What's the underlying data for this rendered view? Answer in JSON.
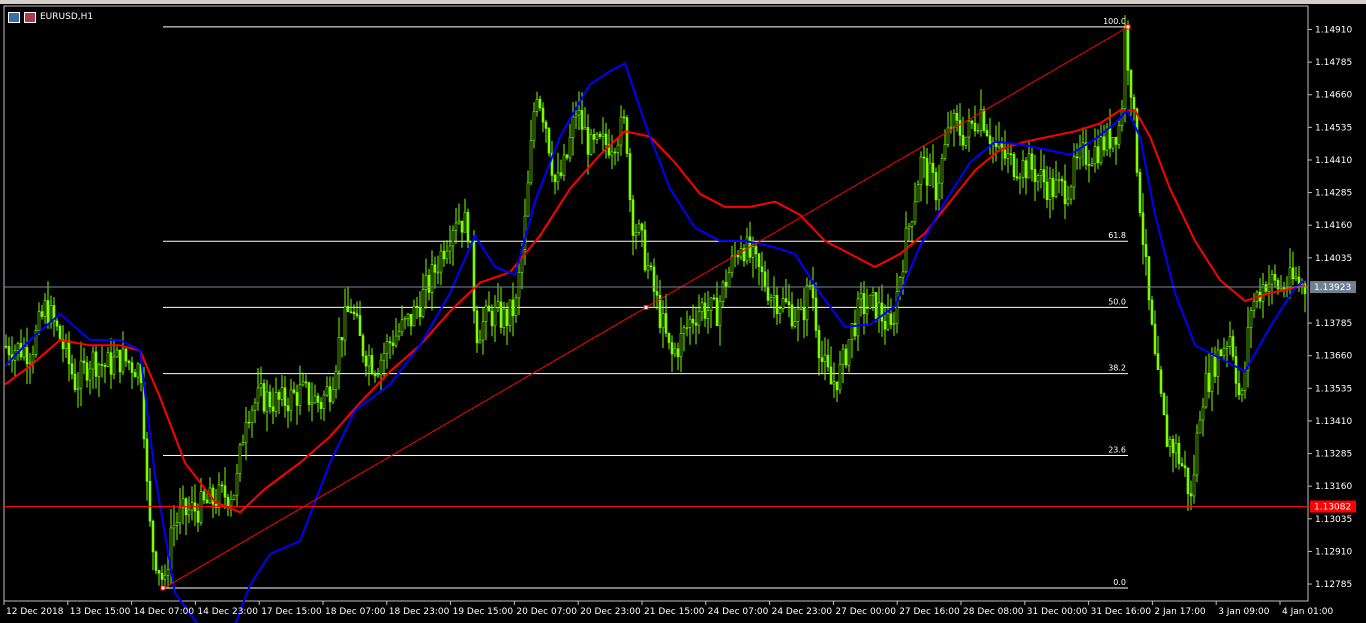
{
  "window": {
    "symbol_title": "EURUSD,H1"
  },
  "colors": {
    "background": "#000000",
    "candle": "#7cfc00",
    "ma_fast": "#0000ff",
    "ma_slow": "#ff0000",
    "fib": "#ffffff",
    "trend": "#ff0000",
    "bid_line": "#778899",
    "hline": "#ff0000"
  },
  "chart_data": {
    "type": "candlestick",
    "symbol": "EURUSD",
    "timeframe": "H1",
    "y_ticks": [
      "1.14910",
      "1.14785",
      "1.14660",
      "1.14535",
      "1.14410",
      "1.14285",
      "1.14160",
      "1.14035",
      "1.13785",
      "1.13660",
      "1.13535",
      "1.13410",
      "1.13285",
      "1.13160",
      "1.13035",
      "1.12910",
      "1.12785"
    ],
    "y_range": [
      1.1272,
      1.15
    ],
    "x_ticks": [
      "12 Dec 2018",
      "13 Dec 15:00",
      "14 Dec 07:00",
      "14 Dec 23:00",
      "17 Dec 15:00",
      "18 Dec 07:00",
      "18 Dec 23:00",
      "19 Dec 15:00",
      "20 Dec 07:00",
      "20 Dec 23:00",
      "21 Dec 15:00",
      "24 Dec 07:00",
      "24 Dec 23:00",
      "27 Dec 00:00",
      "27 Dec 16:00",
      "28 Dec 08:00",
      "31 Dec 00:00",
      "31 Dec 16:00",
      "2 Jan 17:00",
      "3 Jan 09:00",
      "4 Jan 01:00"
    ],
    "current_price": {
      "label": "1.13923",
      "value": 1.13923
    },
    "horizontal_line": {
      "label": "1.13082",
      "value": 1.13082
    },
    "fibonacci": {
      "from": 1.1277,
      "to": 1.1492,
      "levels": [
        {
          "label": "100.0",
          "ratio": 1.0
        },
        {
          "label": "61.8",
          "ratio": 0.618
        },
        {
          "label": "50.0",
          "ratio": 0.5
        },
        {
          "label": "38.2",
          "ratio": 0.382
        },
        {
          "label": "23.6",
          "ratio": 0.236
        },
        {
          "label": "0.0",
          "ratio": 0.0
        }
      ]
    },
    "close_path": [
      [
        0,
        1.137
      ],
      [
        30,
        1.1368
      ],
      [
        45,
        1.1385
      ],
      [
        60,
        1.1372
      ],
      [
        75,
        1.1355
      ],
      [
        90,
        1.1365
      ],
      [
        105,
        1.1362
      ],
      [
        120,
        1.1365
      ],
      [
        135,
        1.1362
      ],
      [
        141,
        1.136
      ],
      [
        145,
        1.132
      ],
      [
        150,
        1.1295
      ],
      [
        158,
        1.1285
      ],
      [
        164,
        1.1277
      ],
      [
        170,
        1.13
      ],
      [
        180,
        1.1305
      ],
      [
        200,
        1.1308
      ],
      [
        220,
        1.1312
      ],
      [
        235,
        1.1315
      ],
      [
        245,
        1.1345
      ],
      [
        260,
        1.135
      ],
      [
        280,
        1.1348
      ],
      [
        300,
        1.1352
      ],
      [
        320,
        1.1348
      ],
      [
        330,
        1.1355
      ],
      [
        340,
        1.1375
      ],
      [
        350,
        1.1385
      ],
      [
        360,
        1.137
      ],
      [
        375,
        1.1362
      ],
      [
        390,
        1.1372
      ],
      [
        410,
        1.138
      ],
      [
        430,
        1.1395
      ],
      [
        445,
        1.141
      ],
      [
        455,
        1.142
      ],
      [
        468,
        1.1415
      ],
      [
        475,
        1.1375
      ],
      [
        490,
        1.1382
      ],
      [
        505,
        1.138
      ],
      [
        515,
        1.1385
      ],
      [
        525,
        1.142
      ],
      [
        535,
        1.147
      ],
      [
        545,
        1.1455
      ],
      [
        555,
        1.143
      ],
      [
        565,
        1.144
      ],
      [
        575,
        1.146
      ],
      [
        590,
        1.1445
      ],
      [
        610,
        1.1448
      ],
      [
        625,
        1.1455
      ],
      [
        630,
        1.142
      ],
      [
        640,
        1.141
      ],
      [
        650,
        1.1395
      ],
      [
        660,
        1.138
      ],
      [
        670,
        1.1365
      ],
      [
        680,
        1.1372
      ],
      [
        690,
        1.138
      ],
      [
        700,
        1.1385
      ],
      [
        715,
        1.1382
      ],
      [
        725,
        1.1395
      ],
      [
        740,
        1.141
      ],
      [
        755,
        1.14
      ],
      [
        770,
        1.139
      ],
      [
        785,
        1.1385
      ],
      [
        800,
        1.138
      ],
      [
        810,
        1.1395
      ],
      [
        820,
        1.1365
      ],
      [
        830,
        1.1355
      ],
      [
        840,
        1.136
      ],
      [
        850,
        1.1375
      ],
      [
        860,
        1.1385
      ],
      [
        875,
        1.1385
      ],
      [
        890,
        1.1375
      ],
      [
        900,
        1.14
      ],
      [
        910,
        1.142
      ],
      [
        920,
        1.144
      ],
      [
        935,
        1.143
      ],
      [
        950,
        1.1455
      ],
      [
        965,
        1.145
      ],
      [
        980,
        1.146
      ],
      [
        995,
        1.1445
      ],
      [
        1010,
        1.144
      ],
      [
        1030,
        1.1438
      ],
      [
        1050,
        1.143
      ],
      [
        1065,
        1.143
      ],
      [
        1080,
        1.1442
      ],
      [
        1095,
        1.1445
      ],
      [
        1110,
        1.145
      ],
      [
        1120,
        1.1455
      ],
      [
        1124,
        1.149
      ],
      [
        1130,
        1.147
      ],
      [
        1140,
        1.142
      ],
      [
        1148,
        1.1385
      ],
      [
        1155,
        1.136
      ],
      [
        1165,
        1.1335
      ],
      [
        1175,
        1.133
      ],
      [
        1185,
        1.132
      ],
      [
        1190,
        1.131
      ],
      [
        1200,
        1.135
      ],
      [
        1215,
        1.1365
      ],
      [
        1230,
        1.1375
      ],
      [
        1240,
        1.1345
      ],
      [
        1250,
        1.1385
      ],
      [
        1265,
        1.1395
      ],
      [
        1280,
        1.1392
      ],
      [
        1295,
        1.1395
      ],
      [
        1305,
        1.1392
      ]
    ],
    "ma_fast_path": [
      [
        5,
        1.1362
      ],
      [
        30,
        1.1372
      ],
      [
        60,
        1.1382
      ],
      [
        90,
        1.1372
      ],
      [
        120,
        1.1372
      ],
      [
        140,
        1.1368
      ],
      [
        155,
        1.132
      ],
      [
        175,
        1.1275
      ],
      [
        200,
        1.1262
      ],
      [
        230,
        1.1258
      ],
      [
        250,
        1.1278
      ],
      [
        270,
        1.129
      ],
      [
        300,
        1.1295
      ],
      [
        330,
        1.1325
      ],
      [
        355,
        1.1345
      ],
      [
        390,
        1.1355
      ],
      [
        420,
        1.137
      ],
      [
        450,
        1.139
      ],
      [
        475,
        1.1412
      ],
      [
        495,
        1.14
      ],
      [
        515,
        1.1397
      ],
      [
        535,
        1.1425
      ],
      [
        560,
        1.145
      ],
      [
        590,
        1.147
      ],
      [
        610,
        1.1475
      ],
      [
        625,
        1.1478
      ],
      [
        645,
        1.1455
      ],
      [
        670,
        1.143
      ],
      [
        695,
        1.1415
      ],
      [
        720,
        1.141
      ],
      [
        745,
        1.141
      ],
      [
        770,
        1.1408
      ],
      [
        795,
        1.1405
      ],
      [
        820,
        1.139
      ],
      [
        845,
        1.1377
      ],
      [
        870,
        1.1378
      ],
      [
        895,
        1.1385
      ],
      [
        920,
        1.1408
      ],
      [
        945,
        1.1425
      ],
      [
        970,
        1.144
      ],
      [
        995,
        1.1448
      ],
      [
        1020,
        1.1447
      ],
      [
        1045,
        1.1445
      ],
      [
        1070,
        1.1443
      ],
      [
        1095,
        1.1449
      ],
      [
        1115,
        1.1455
      ],
      [
        1127,
        1.146
      ],
      [
        1140,
        1.145
      ],
      [
        1155,
        1.142
      ],
      [
        1175,
        1.139
      ],
      [
        1195,
        1.137
      ],
      [
        1220,
        1.1365
      ],
      [
        1245,
        1.136
      ],
      [
        1270,
        1.1377
      ],
      [
        1295,
        1.1392
      ],
      [
        1305,
        1.1395
      ]
    ],
    "ma_slow_path": [
      [
        5,
        1.1355
      ],
      [
        30,
        1.1362
      ],
      [
        60,
        1.1372
      ],
      [
        90,
        1.137
      ],
      [
        120,
        1.137
      ],
      [
        140,
        1.1368
      ],
      [
        160,
        1.135
      ],
      [
        185,
        1.1325
      ],
      [
        215,
        1.131
      ],
      [
        240,
        1.1306
      ],
      [
        265,
        1.1315
      ],
      [
        300,
        1.1325
      ],
      [
        330,
        1.1335
      ],
      [
        360,
        1.1348
      ],
      [
        390,
        1.136
      ],
      [
        420,
        1.137
      ],
      [
        450,
        1.1383
      ],
      [
        480,
        1.1394
      ],
      [
        510,
        1.1398
      ],
      [
        540,
        1.1412
      ],
      [
        570,
        1.143
      ],
      [
        600,
        1.1443
      ],
      [
        625,
        1.1452
      ],
      [
        650,
        1.145
      ],
      [
        675,
        1.144
      ],
      [
        700,
        1.1428
      ],
      [
        725,
        1.1423
      ],
      [
        750,
        1.1423
      ],
      [
        775,
        1.1425
      ],
      [
        800,
        1.142
      ],
      [
        825,
        1.141
      ],
      [
        850,
        1.1405
      ],
      [
        875,
        1.14
      ],
      [
        900,
        1.1405
      ],
      [
        925,
        1.1413
      ],
      [
        950,
        1.1425
      ],
      [
        975,
        1.1437
      ],
      [
        1000,
        1.1445
      ],
      [
        1025,
        1.1448
      ],
      [
        1050,
        1.145
      ],
      [
        1075,
        1.1452
      ],
      [
        1100,
        1.1455
      ],
      [
        1120,
        1.146
      ],
      [
        1135,
        1.146
      ],
      [
        1150,
        1.145
      ],
      [
        1170,
        1.143
      ],
      [
        1195,
        1.141
      ],
      [
        1220,
        1.1395
      ],
      [
        1245,
        1.1387
      ],
      [
        1270,
        1.139
      ],
      [
        1295,
        1.1392
      ],
      [
        1305,
        1.1393
      ]
    ]
  }
}
